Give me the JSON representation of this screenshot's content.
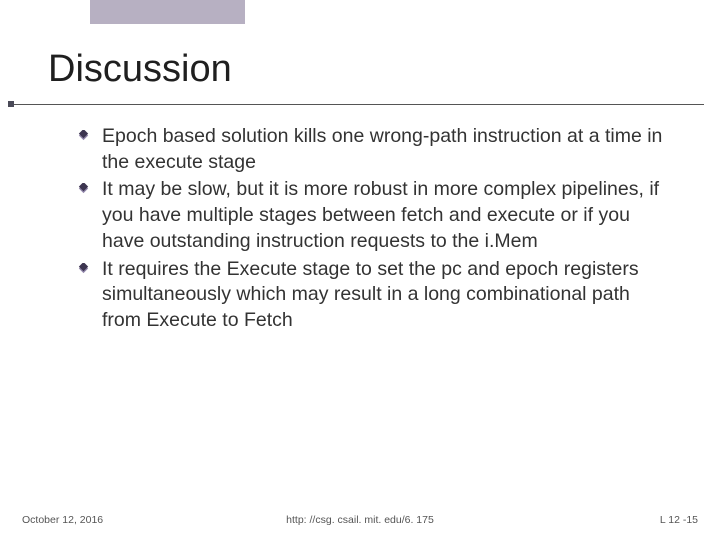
{
  "title": "Discussion",
  "bullets": [
    "Epoch based solution kills one wrong-path instruction at a time in the execute stage",
    "It may be slow, but it is more robust in more complex pipelines, if you have multiple stages between fetch and execute or if you have outstanding instruction requests to the i.Mem",
    "It requires the Execute stage to set the pc and epoch registers simultaneously which may result in a long combinational path from Execute to Fetch"
  ],
  "footer": {
    "date": "October 12, 2016",
    "url": "http: //csg. csail. mit. edu/6. 175",
    "slide_number": "L 12 -15"
  },
  "colors": {
    "accent_block": "#b7b0c2",
    "bullet_dark": "#3c3550",
    "bullet_light": "#8f84a8"
  }
}
